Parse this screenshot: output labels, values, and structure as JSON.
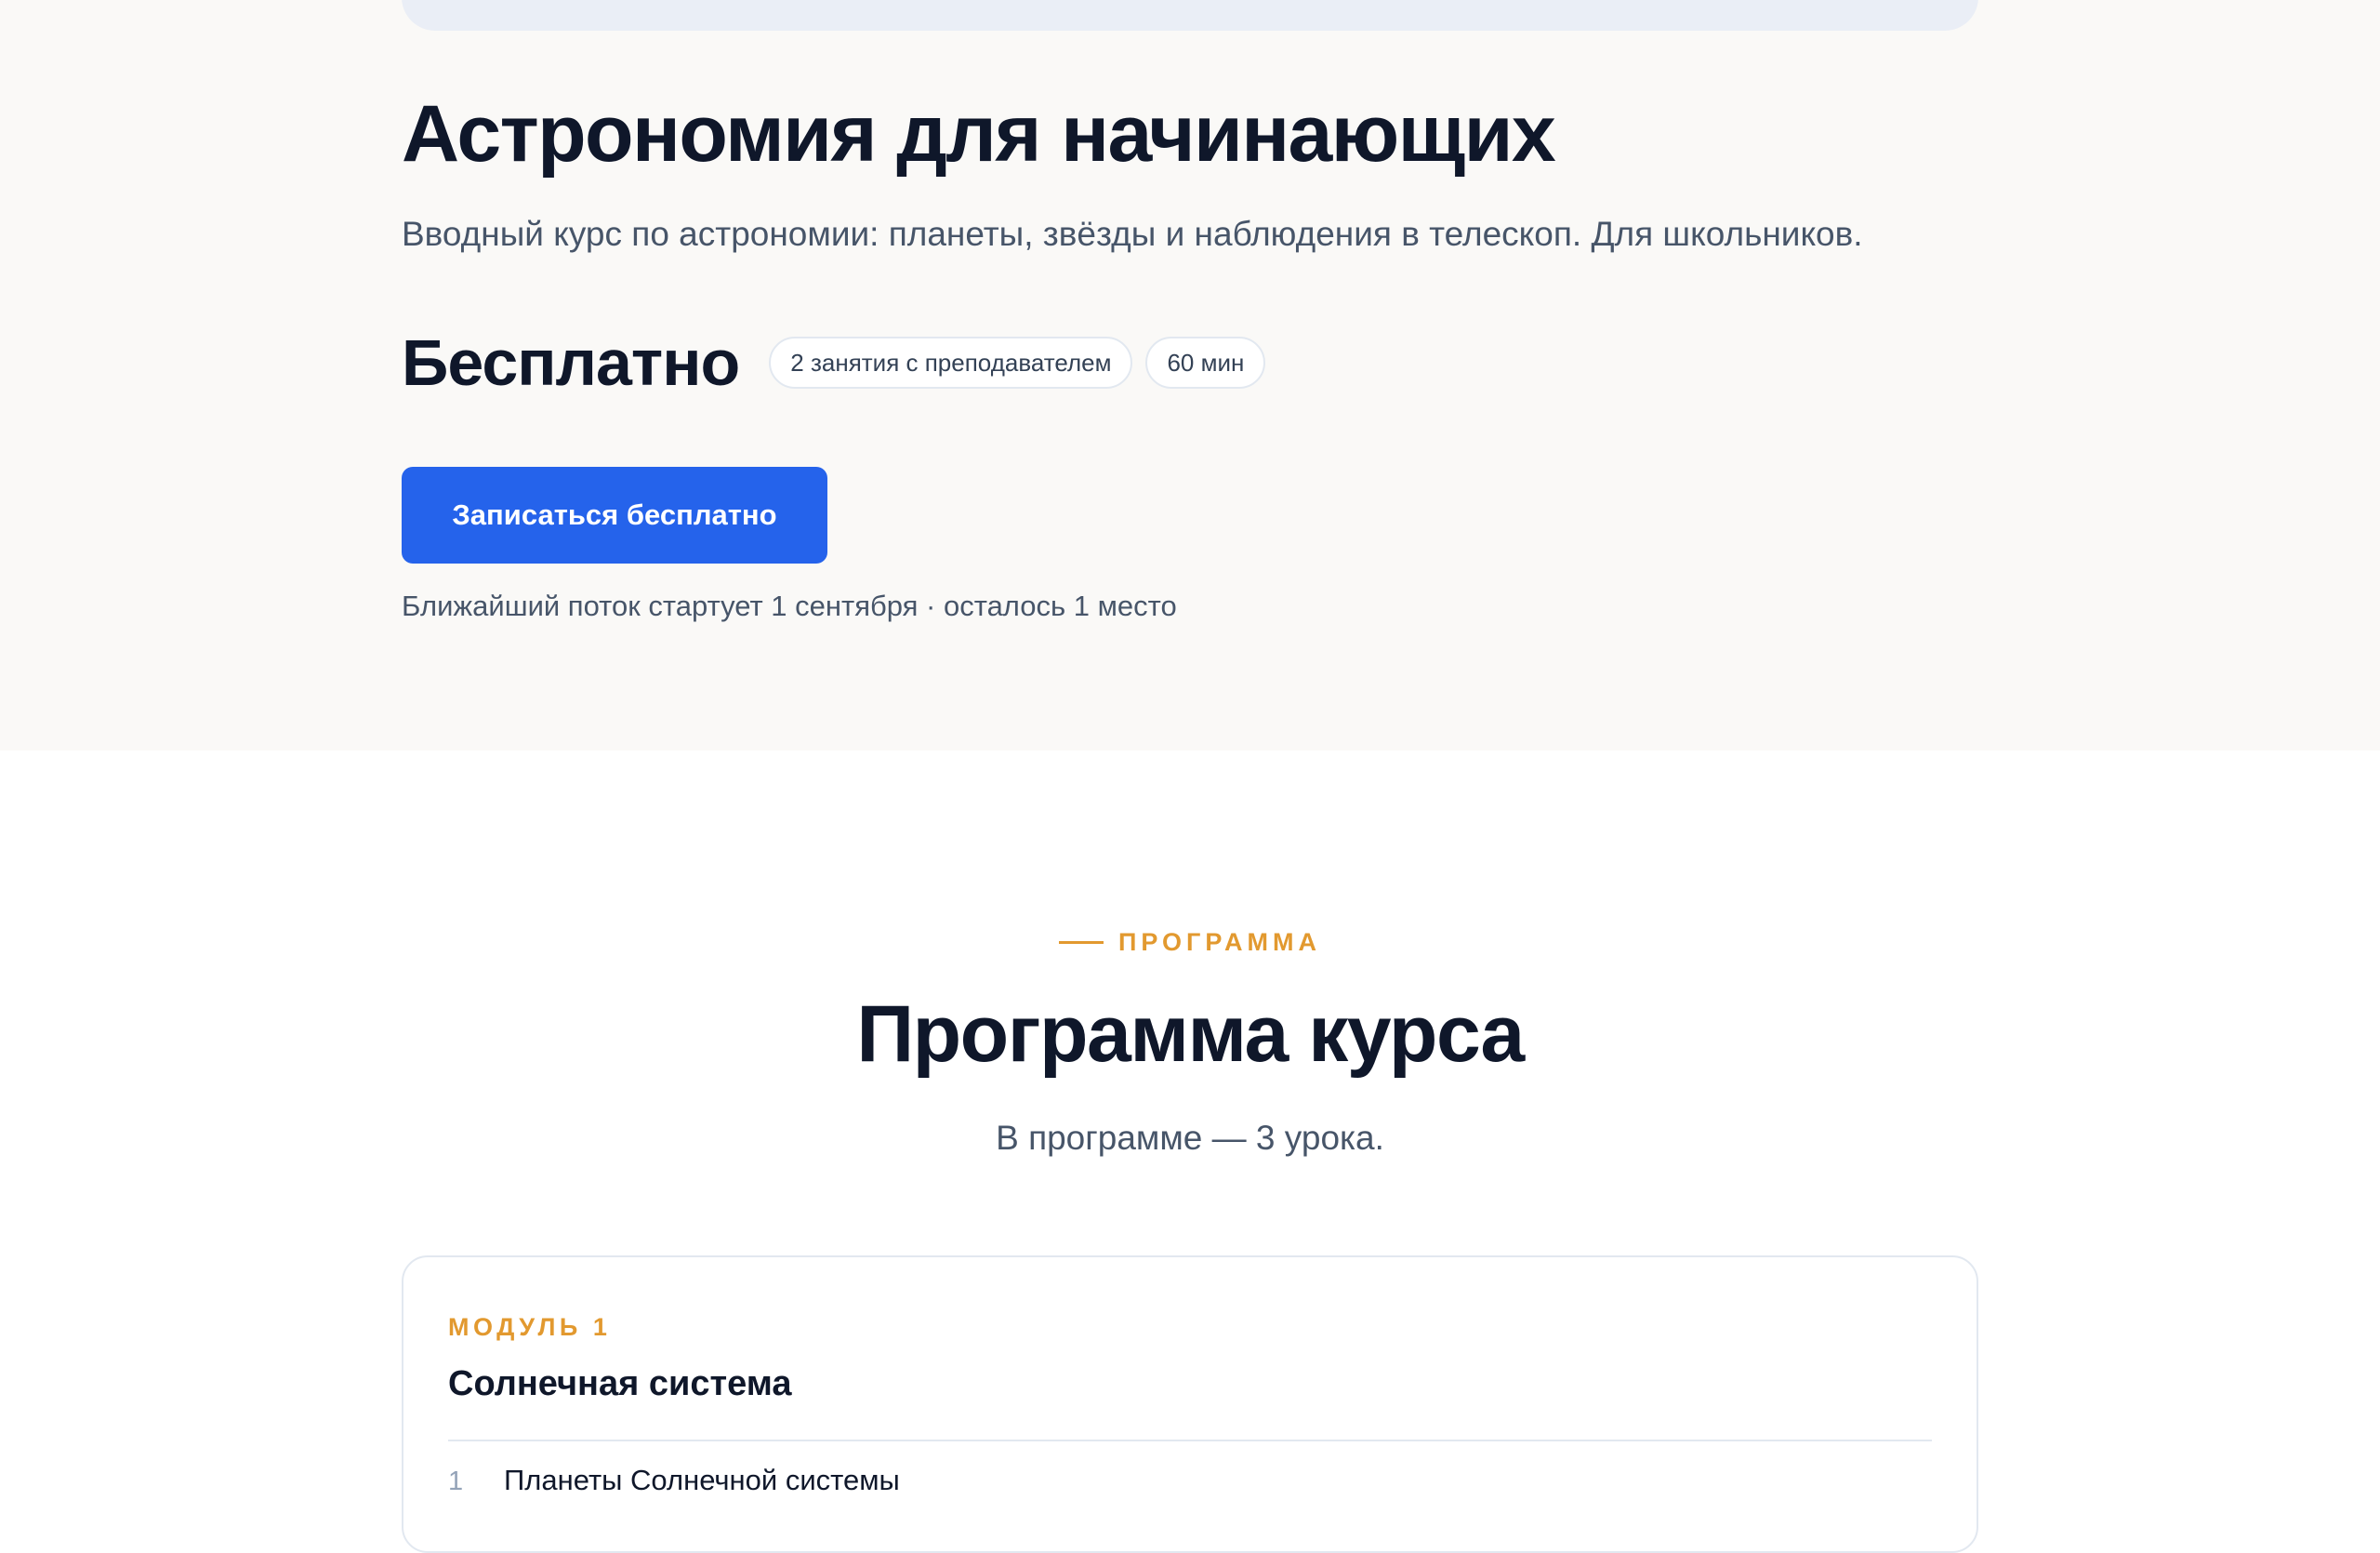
{
  "course": {
    "title": "Астрономия для начинающих",
    "description": "Вводный курс по астрономии: планеты, звёзды и наблюдения в телескоп. Для школьников.",
    "price": "Бесплатно",
    "chips": [
      "2 занятия с преподавателем",
      "60 мин"
    ],
    "enroll_label": "Записаться бесплатно",
    "next_stream": "Ближайший поток стартует 1 сентября · осталось 1 место"
  },
  "program": {
    "eyebrow": "ПРОГРАММА",
    "title": "Программа курса",
    "subtitle": "В программе — 3 урока.",
    "modules": [
      {
        "label": "МОДУЛЬ 1",
        "title": "Солнечная система",
        "lessons": [
          {
            "number": "1",
            "title": "Планеты Солнечной системы"
          }
        ]
      }
    ]
  },
  "colors": {
    "accent": "#2563eb",
    "eyebrow": "#e2992f",
    "hero_background": "#faf9f7"
  }
}
